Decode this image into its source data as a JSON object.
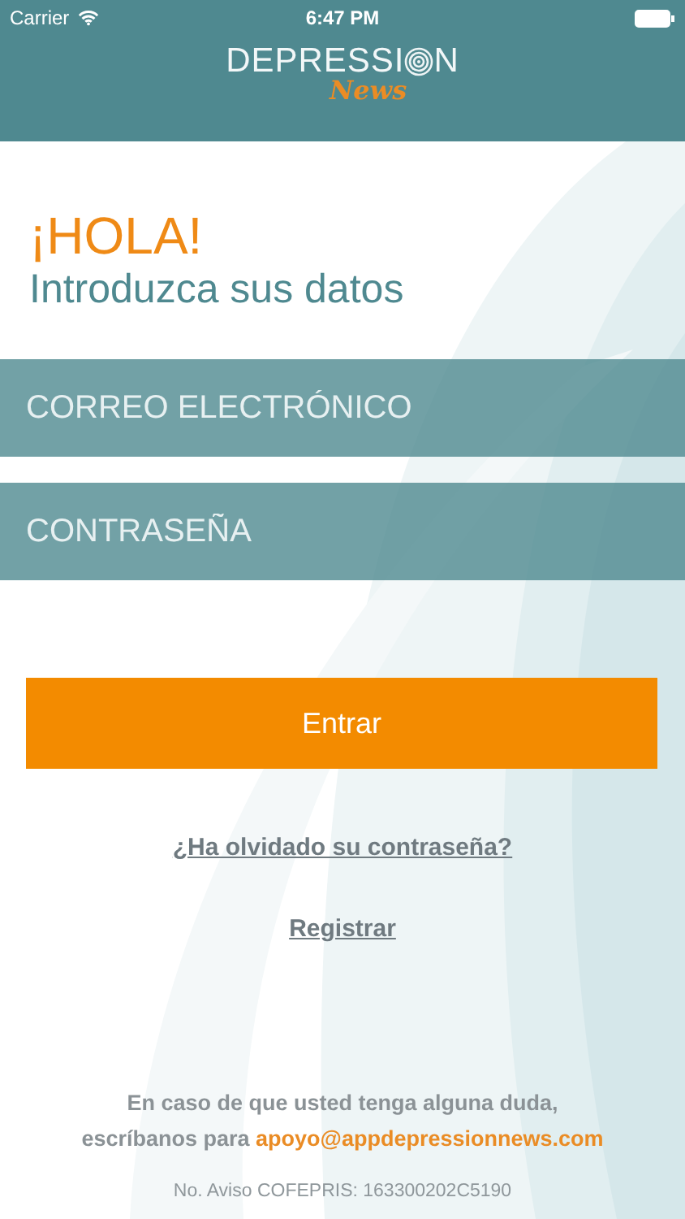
{
  "status_bar": {
    "carrier": "Carrier",
    "time": "6:47 PM"
  },
  "header": {
    "logo_start": "DEPRESSI",
    "logo_end": "N",
    "logo_script": "News"
  },
  "greeting": {
    "title": "¡HOLA!",
    "subtitle": "Introduzca sus datos"
  },
  "fields": [
    {
      "placeholder": "CORREO ELECTRÓNICO"
    },
    {
      "placeholder": "CONTRASEÑA"
    }
  ],
  "submit_button": "Entrar",
  "links": [
    "¿Ha olvidado su contraseña?",
    "Registrar"
  ],
  "help": {
    "line_1": "En caso de que usted tenga alguna duda,",
    "line_2": "escríbanos para",
    "email": "apoyo@appdepressionnews.com"
  },
  "notice": "No. Aviso COFEPRIS: 163300202C5190"
}
